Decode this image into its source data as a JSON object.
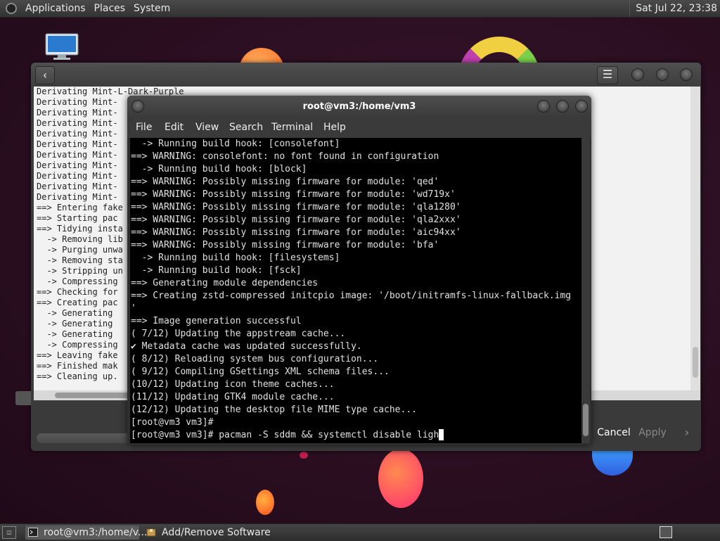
{
  "top_panel": {
    "menus": [
      "Applications",
      "Places",
      "System"
    ],
    "clock": "Sat Jul 22, 23:38"
  },
  "software_window": {
    "log_lines": [
      "Derivating Mint-L-Dark-Purple",
      "Derivating Mint-",
      "Derivating Mint-",
      "Derivating Mint-",
      "Derivating Mint-",
      "Derivating Mint-",
      "Derivating Mint-",
      "Derivating Mint-",
      "Derivating Mint-",
      "Derivating Mint-",
      "Derivating Mint-",
      "==> Entering fake",
      "==> Starting pac",
      "==> Tidying insta",
      "  -> Removing lib",
      "  -> Purging unwa",
      "  -> Removing sta",
      "  -> Stripping un",
      "  -> Compressing",
      "==> Checking for",
      "==> Creating pac",
      "  -> Generating",
      "  -> Generating",
      "  -> Generating",
      "  -> Compressing",
      "==> Leaving fake",
      "==> Finished mak",
      "==> Cleaning up."
    ],
    "cancel_label": "Cancel",
    "apply_label": "Apply"
  },
  "terminal": {
    "title": "root@vm3:/home/vm3",
    "menu": [
      "File",
      "Edit",
      "View",
      "Search",
      "Terminal",
      "Help"
    ],
    "lines": [
      "  -> Running build hook: [consolefont]",
      "==> WARNING: consolefont: no font found in configuration",
      "  -> Running build hook: [block]",
      "==> WARNING: Possibly missing firmware for module: 'qed'",
      "==> WARNING: Possibly missing firmware for module: 'wd719x'",
      "==> WARNING: Possibly missing firmware for module: 'qla1280'",
      "==> WARNING: Possibly missing firmware for module: 'qla2xxx'",
      "==> WARNING: Possibly missing firmware for module: 'aic94xx'",
      "==> WARNING: Possibly missing firmware for module: 'bfa'",
      "  -> Running build hook: [filesystems]",
      "  -> Running build hook: [fsck]",
      "==> Generating module dependencies",
      "==> Creating zstd-compressed initcpio image: '/boot/initramfs-linux-fallback.img",
      "'",
      "==> Image generation successful",
      "( 7/12) Updating the appstream cache...",
      "✔ Metadata cache was updated successfully.",
      "( 8/12) Reloading system bus configuration...",
      "( 9/12) Compiling GSettings XML schema files...",
      "(10/12) Updating icon theme caches...",
      "(11/12) Updating GTK4 module cache...",
      "(12/12) Updating the desktop file MIME type cache...",
      "[root@vm3 vm3]#"
    ],
    "prompt_line": "[root@vm3 vm3]# pacman -S sddm && systemctl disable ligh"
  },
  "taskbar": {
    "show_desktop_label": "◫",
    "tasks": [
      "root@vm3:/home/v...",
      "Add/Remove Software"
    ]
  }
}
